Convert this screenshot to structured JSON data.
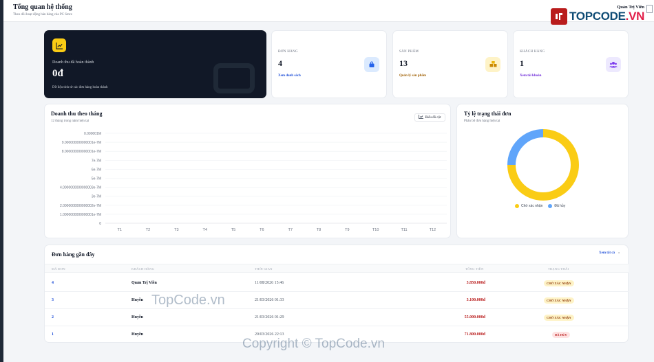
{
  "header": {
    "title": "Tổng quan hệ thống",
    "subtitle": "Theo dõi hoạt động bán hàng của PC Store",
    "user_name": "Quản Trị Viên"
  },
  "logo": {
    "text_main": "TOPCODE",
    "text_suffix": ".VN",
    "accent": "#b91c1c"
  },
  "hero": {
    "label": "Doanh thu đã hoàn thành",
    "value": "0đ",
    "note": "Dữ liệu tính từ các đơn hàng hoàn thành",
    "icon": "line-chart-icon",
    "accent": "#facc15"
  },
  "stats": [
    {
      "label": "ĐƠN HÀNG",
      "value": "4",
      "link": "Xem danh sách",
      "icon": "bag-icon",
      "icon_color": "#2563eb",
      "icon_bg": "#dbeafe",
      "link_color": "#1d4ed8"
    },
    {
      "label": "SẢN PHẨM",
      "value": "13",
      "link": "Quản lý sản phẩm",
      "icon": "boxes-icon",
      "icon_color": "#ca8a04",
      "icon_bg": "#fef3c7",
      "link_color": "#a16207"
    },
    {
      "label": "KHÁCH HÀNG",
      "value": "1",
      "link": "Xem tài khoản",
      "icon": "users-icon",
      "icon_color": "#7c3aed",
      "icon_bg": "#ede9fe",
      "link_color": "#6d28d9"
    }
  ],
  "revenue_chart": {
    "title": "Doanh thu theo tháng",
    "subtitle": "12 tháng trong năm hiện tại",
    "button": "Biểu đồ cột",
    "button_icon": "bar-chart-icon"
  },
  "status_chart": {
    "title": "Tỷ lệ trạng thái đơn",
    "subtitle": "Phân bổ đơn hàng hiện tại"
  },
  "chart_data": [
    {
      "type": "bar",
      "title": "Doanh thu theo tháng",
      "subtitle": "12 tháng trong năm hiện tại",
      "categories": [
        "T1",
        "T2",
        "T3",
        "T4",
        "T5",
        "T6",
        "T7",
        "T8",
        "T9",
        "T10",
        "T11",
        "T12"
      ],
      "values": [
        0,
        0,
        0,
        0,
        0,
        0,
        0,
        0,
        0,
        0,
        0,
        0
      ],
      "y_tick_labels": [
        "0",
        "1.0000000000000001e-7M",
        "2.0000000000000002e-7M",
        "3e-7M",
        "4.0000000000000003e-7M",
        "5e-7M",
        "6e-7M",
        "7e-7M",
        "8.000000000000001e-7M",
        "9.000000000000001e-7M",
        "0.000001M"
      ],
      "ylim": [
        0,
        1e-06
      ],
      "grid": true
    },
    {
      "type": "pie",
      "title": "Tỷ lệ trạng thái đơn",
      "subtitle": "Phân bổ đơn hàng hiện tại",
      "labels": [
        "Chờ xác nhận",
        "Đã hủy"
      ],
      "values": [
        3,
        1
      ],
      "colors": [
        "#facc15",
        "#60a5fa"
      ],
      "legend": "bottom"
    }
  ],
  "orders": {
    "title": "Đơn hàng gần đây",
    "view_all": "Xem tất cả",
    "columns": [
      "MÃ ĐƠN",
      "KHÁCH HÀNG",
      "THỜI GIAN",
      "TỔNG TIỀN",
      "TRẠNG THÁI"
    ],
    "rows": [
      {
        "id": "4",
        "customer": "Quản Trị Viên",
        "time": "11/08/2026 15:46",
        "total": "3.850.000đ",
        "status": "CHỜ XÁC NHẬN",
        "status_type": "pending"
      },
      {
        "id": "3",
        "customer": "Huyền",
        "time": "21/03/2026 01:33",
        "total": "3.100.000đ",
        "status": "CHỜ XÁC NHẬN",
        "status_type": "pending"
      },
      {
        "id": "2",
        "customer": "Huyền",
        "time": "21/03/2026 01:29",
        "total": "55.000.000đ",
        "status": "CHỜ XÁC NHẬN",
        "status_type": "pending"
      },
      {
        "id": "1",
        "customer": "Huyền",
        "time": "20/03/2026 22:13",
        "total": "71.800.000đ",
        "status": "ĐÃ HỦY",
        "status_type": "cancel"
      }
    ]
  },
  "watermarks": [
    "TopCode.vn",
    "Copyright © TopCode.vn"
  ]
}
